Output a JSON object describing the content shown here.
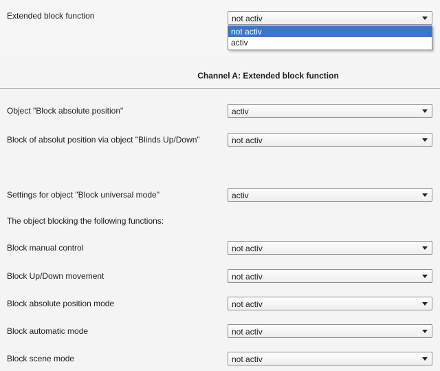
{
  "top": {
    "label": "Extended block function",
    "value": "not activ",
    "options": [
      "not activ",
      "activ"
    ]
  },
  "section": {
    "title": "Channel A: Extended block function"
  },
  "rows": [
    {
      "label": "Object \"Block absolute position\"",
      "value": "activ"
    },
    {
      "label": "Block of absolut position via object \"Blinds Up/Down\"",
      "value": "not activ"
    },
    {
      "label": "Settings for object \"Block universal mode\"",
      "value": "activ"
    },
    {
      "label": "Block manual control",
      "value": "not activ"
    },
    {
      "label": "Block Up/Down movement",
      "value": "not activ"
    },
    {
      "label": "Block absolute position mode",
      "value": "not activ"
    },
    {
      "label": "Block automatic mode",
      "value": "not activ"
    },
    {
      "label": "Block scene mode",
      "value": "not activ"
    }
  ],
  "info": {
    "text": "The object blocking the following functions:"
  }
}
